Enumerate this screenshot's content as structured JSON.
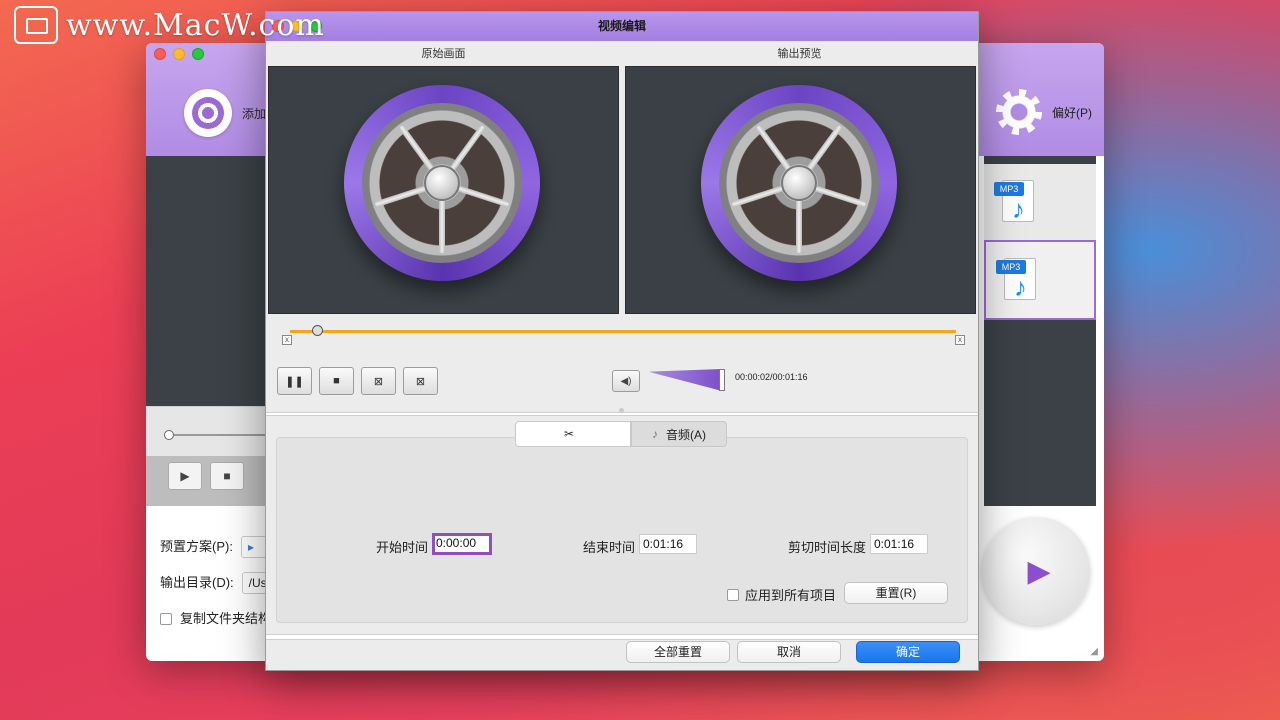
{
  "watermark": {
    "text": "www.MacW.com"
  },
  "main_window": {
    "add_label": "添加",
    "pref_label": "偏好(P)",
    "list_tags": [
      "MP3",
      "MP3"
    ],
    "preset_label": "预置方案(P):",
    "output_label": "输出目录(D):",
    "output_value": "/Us",
    "copy_folder_label": "复制文件夹结构"
  },
  "dialog": {
    "title": "视频编辑",
    "original_label": "原始画面",
    "preview_label": "输出预览",
    "timecode": "00:00:02/00:01:16",
    "tabs": [
      {
        "icon": "scissors-icon",
        "label": ""
      },
      {
        "icon": "music-note-icon",
        "label": "音频(A)"
      }
    ],
    "trim": {
      "start_label": "开始时间",
      "start_value": "0:00:00",
      "end_label": "结束时间",
      "end_value": "0:01:16",
      "duration_label": "剪切时间长度",
      "duration_value": "0:01:16"
    },
    "apply_all_label": "应用到所有项目",
    "reset_label": "重置(R)",
    "reset_all_label": "全部重置",
    "cancel_label": "取消",
    "ok_label": "确定"
  },
  "colors": {
    "accent_purple": "#a37fe0",
    "progress_orange": "#f4a41d",
    "primary_blue": "#1776ee"
  }
}
